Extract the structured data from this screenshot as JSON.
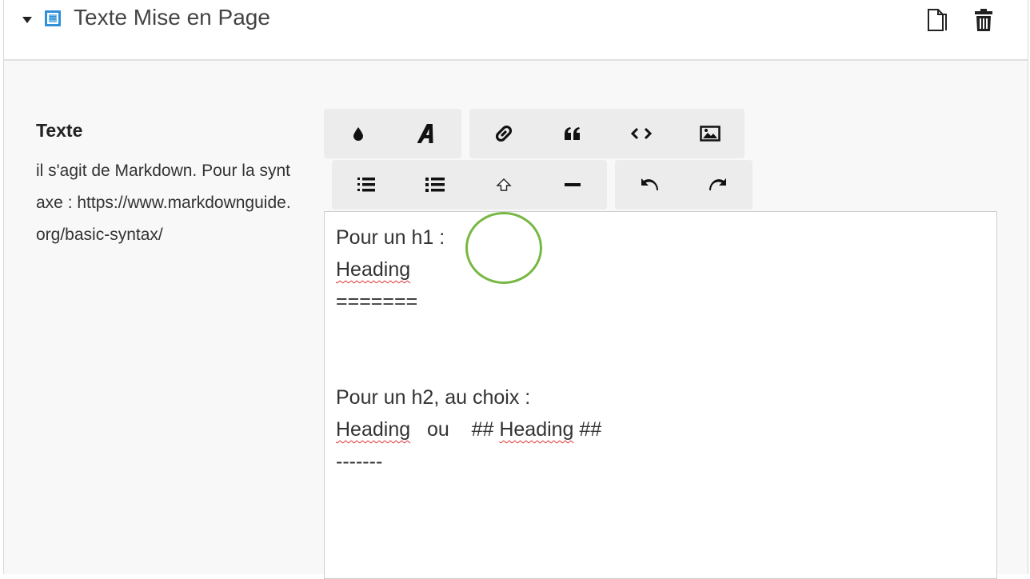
{
  "header": {
    "title": "Texte Mise en Page",
    "icons": [
      "caret-down-icon",
      "block-icon",
      "duplicate-icon",
      "trash-icon"
    ]
  },
  "field": {
    "label": "Texte",
    "help": "il s'agit de Markdown. Pour la syntaxe : https://www.markdownguide.org/basic-syntax/"
  },
  "toolbar": {
    "row1_group1": [
      "color-drop-icon",
      "font-icon"
    ],
    "row1_group2": [
      "link-icon",
      "quote-icon",
      "code-icon",
      "image-icon"
    ],
    "row2_group1": [
      "ordered-list-icon",
      "unordered-list-icon",
      "heading-icon",
      "horizontal-rule-icon"
    ],
    "row2_group2": [
      "undo-icon",
      "redo-icon"
    ],
    "highlighted": "heading-icon"
  },
  "editor": {
    "l1": "Pour un h1 :",
    "l2": "Heading",
    "l3": "=======",
    "l6": "Pour un h2, au choix :",
    "l7a": "Heading",
    "l7b": "   ou    ## ",
    "l7c": "Heading",
    "l7d": " ##",
    "l8": "-------"
  },
  "colors": {
    "highlight": "#77b843",
    "block_icon": "#2f8fd8",
    "spellcheck": "#dd3333"
  }
}
